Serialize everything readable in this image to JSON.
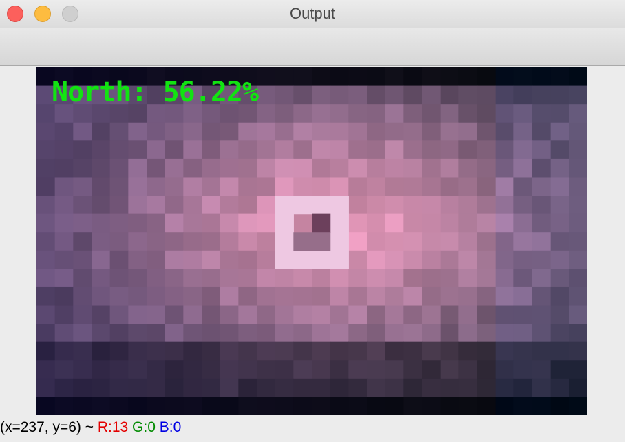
{
  "window": {
    "title": "Output"
  },
  "image": {
    "overlay_text": "North: 56.22%",
    "overlay_color": "#12e312"
  },
  "status": {
    "coords": "(x=237, y=6) ~ ",
    "r": "R:13",
    "g": "G:0",
    "b": "B:0",
    "r_color": "#e30000",
    "g_color": "#008a00",
    "b_color": "#0000e3"
  }
}
